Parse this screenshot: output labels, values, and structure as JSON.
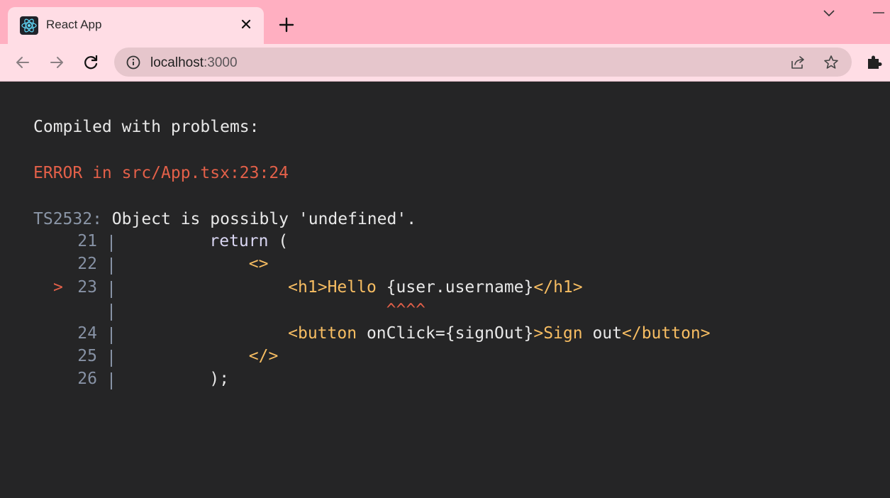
{
  "browser": {
    "tab_title": "React App",
    "url_host": "localhost",
    "url_port": ":3000"
  },
  "overlay": {
    "heading": "Compiled with problems:",
    "error_title": "ERROR in src/App.tsx:23:24",
    "ts_code": "TS2532:",
    "ts_message": " Object is possibly 'undefined'.",
    "marker": ">",
    "lines": [
      {
        "no": "21",
        "indent": "    ",
        "parts": [
          {
            "t": "return",
            "c": "kw"
          },
          {
            "t": " (",
            "c": "plain"
          }
        ]
      },
      {
        "no": "22",
        "indent": "        ",
        "parts": [
          {
            "t": "<>",
            "c": "tag"
          }
        ]
      },
      {
        "no": "23",
        "indent": "            ",
        "parts": [
          {
            "t": "<h1>",
            "c": "tag"
          },
          {
            "t": "Hello",
            "c": "tag"
          },
          {
            "t": " {user.username}",
            "c": "plain"
          },
          {
            "t": "</h1>",
            "c": "tag"
          }
        ]
      },
      {
        "no": "",
        "indent": "                      ",
        "parts": [
          {
            "t": "^^^^",
            "c": "caret"
          }
        ]
      },
      {
        "no": "24",
        "indent": "            ",
        "parts": [
          {
            "t": "<button",
            "c": "tag"
          },
          {
            "t": " onClick={signOut}",
            "c": "plain"
          },
          {
            "t": ">Sign",
            "c": "tag"
          },
          {
            "t": " out",
            "c": "plain"
          },
          {
            "t": "</button>",
            "c": "tag"
          }
        ]
      },
      {
        "no": "25",
        "indent": "        ",
        "parts": [
          {
            "t": "</>",
            "c": "tag"
          }
        ]
      },
      {
        "no": "26",
        "indent": "    ",
        "parts": [
          {
            "t": ");",
            "c": "plain"
          }
        ]
      }
    ]
  },
  "colors": {
    "tabbar_bg": "#ffafc1",
    "tab_bg": "#ffdde5",
    "overlay_bg": "#252526",
    "error_red": "#e36049",
    "tag_orange": "#f7bd62"
  }
}
